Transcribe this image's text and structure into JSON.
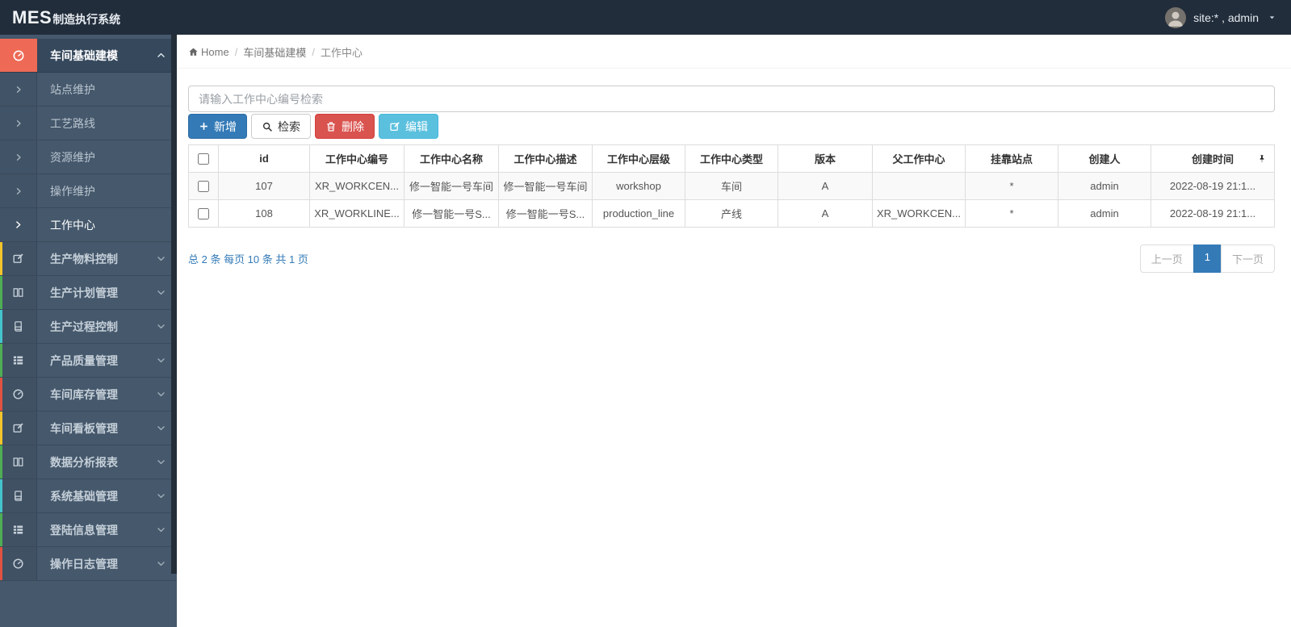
{
  "navbar": {
    "logo_mes": "MES",
    "logo_suffix": "制造执行系统",
    "user_label": "site:* , admin"
  },
  "sidebar": {
    "root_active": {
      "label": "车间基础建模",
      "icon": "dashboard-icon"
    },
    "submenu": [
      "站点维护",
      "工艺路线",
      "资源维护",
      "操作维护",
      "工作中心"
    ],
    "active_submenu": "工作中心",
    "groups": [
      {
        "label": "生产物料控制",
        "icon": "edit-icon",
        "strip_style": "background:#f4c42c"
      },
      {
        "label": "生产计划管理",
        "icon": "columns-icon",
        "strip_style": "background:#4fae54"
      },
      {
        "label": "生产过程控制",
        "icon": "book-icon",
        "strip_style": "background:#45c3cd"
      },
      {
        "label": "产品质量管理",
        "icon": "list-icon",
        "strip_style": "background:#4fae54"
      },
      {
        "label": "车间库存管理",
        "icon": "dashboard-icon",
        "strip_style": "background:#e15241"
      },
      {
        "label": "车间看板管理",
        "icon": "edit-icon",
        "strip_style": "background:#f4c42c"
      },
      {
        "label": "数据分析报表",
        "icon": "columns-icon",
        "strip_style": "background:#4fae54"
      },
      {
        "label": "系统基础管理",
        "icon": "book-icon",
        "strip_style": "background:#45c3cd"
      },
      {
        "label": "登陆信息管理",
        "icon": "list-icon",
        "strip_style": "background:#4fae54"
      },
      {
        "label": "操作日志管理",
        "icon": "dashboard-icon",
        "strip_style": "background:#e15241"
      }
    ]
  },
  "breadcrumb": {
    "home": "Home",
    "separator": "/",
    "level1": "车间基础建模",
    "level2": "工作中心"
  },
  "search": {
    "placeholder": "请输入工作中心编号检索"
  },
  "toolbar": {
    "add_label": "新增",
    "search_label": "检索",
    "delete_label": "删除",
    "edit_label": "编辑"
  },
  "table": {
    "headers": [
      "id",
      "工作中心编号",
      "工作中心名称",
      "工作中心描述",
      "工作中心层级",
      "工作中心类型",
      "版本",
      "父工作中心",
      "挂靠站点",
      "创建人",
      "创建时间"
    ],
    "rows": [
      [
        "107",
        "XR_WORKCEN...",
        "修一智能一号车间",
        "修一智能一号车间",
        "workshop",
        "车间",
        "A",
        "",
        "*",
        "admin",
        "2022-08-19 21:1..."
      ],
      [
        "108",
        "XR_WORKLINE...",
        "修一智能一号S...",
        "修一智能一号S...",
        "production_line",
        "产线",
        "A",
        "XR_WORKCEN...",
        "*",
        "admin",
        "2022-08-19 21:1..."
      ]
    ]
  },
  "pagination": {
    "summary": "总 2 条  每页 10 条  共 1 页",
    "prev": "上一页",
    "current": "1",
    "next": "下一页"
  },
  "colors": {
    "navbar_bg": "#222d3b",
    "sidebar_bg": "#45586c",
    "active_icon_red": "#ee6a56",
    "primary": "#337ab7",
    "danger": "#d9534f",
    "info": "#5bc0de",
    "strip_yellow": "#f4c42c",
    "strip_green": "#4fae54",
    "strip_teal": "#45c3cd",
    "strip_red": "#e15241"
  }
}
